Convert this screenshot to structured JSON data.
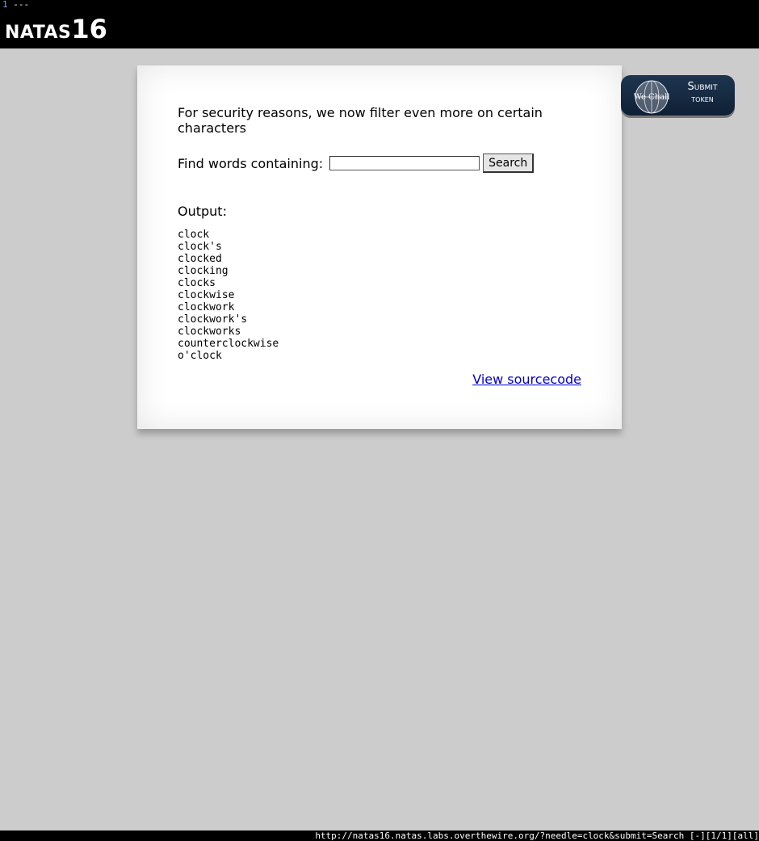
{
  "tabbar": {
    "tab_number": "1",
    "tab_title": "---"
  },
  "header": {
    "logo_word": "NATAS",
    "logo_number": "16"
  },
  "content": {
    "intro": "For security reasons, we now filter even more on certain characters",
    "search": {
      "label": "Find words containing:",
      "input_value": "",
      "button_label": "Search"
    },
    "output": {
      "label": "Output:",
      "words": [
        "clock",
        "clock's",
        "clocked",
        "clocking",
        "clocks",
        "clockwise",
        "clockwork",
        "clockwork's",
        "clockworks",
        "counterclockwise",
        "o'clock"
      ]
    },
    "source_link": "View sourcecode"
  },
  "wechall": {
    "emblem_text": "We Chall",
    "line1": "Submit",
    "line2": "token"
  },
  "statusbar": {
    "url": "http://natas16.natas.labs.overthewire.org/?needle=clock&submit=Search [-][1/1][all]"
  },
  "colors": {
    "background": "#cccccc",
    "header": "#000000",
    "link": "#0000cc",
    "badge": "#1a2e45"
  }
}
